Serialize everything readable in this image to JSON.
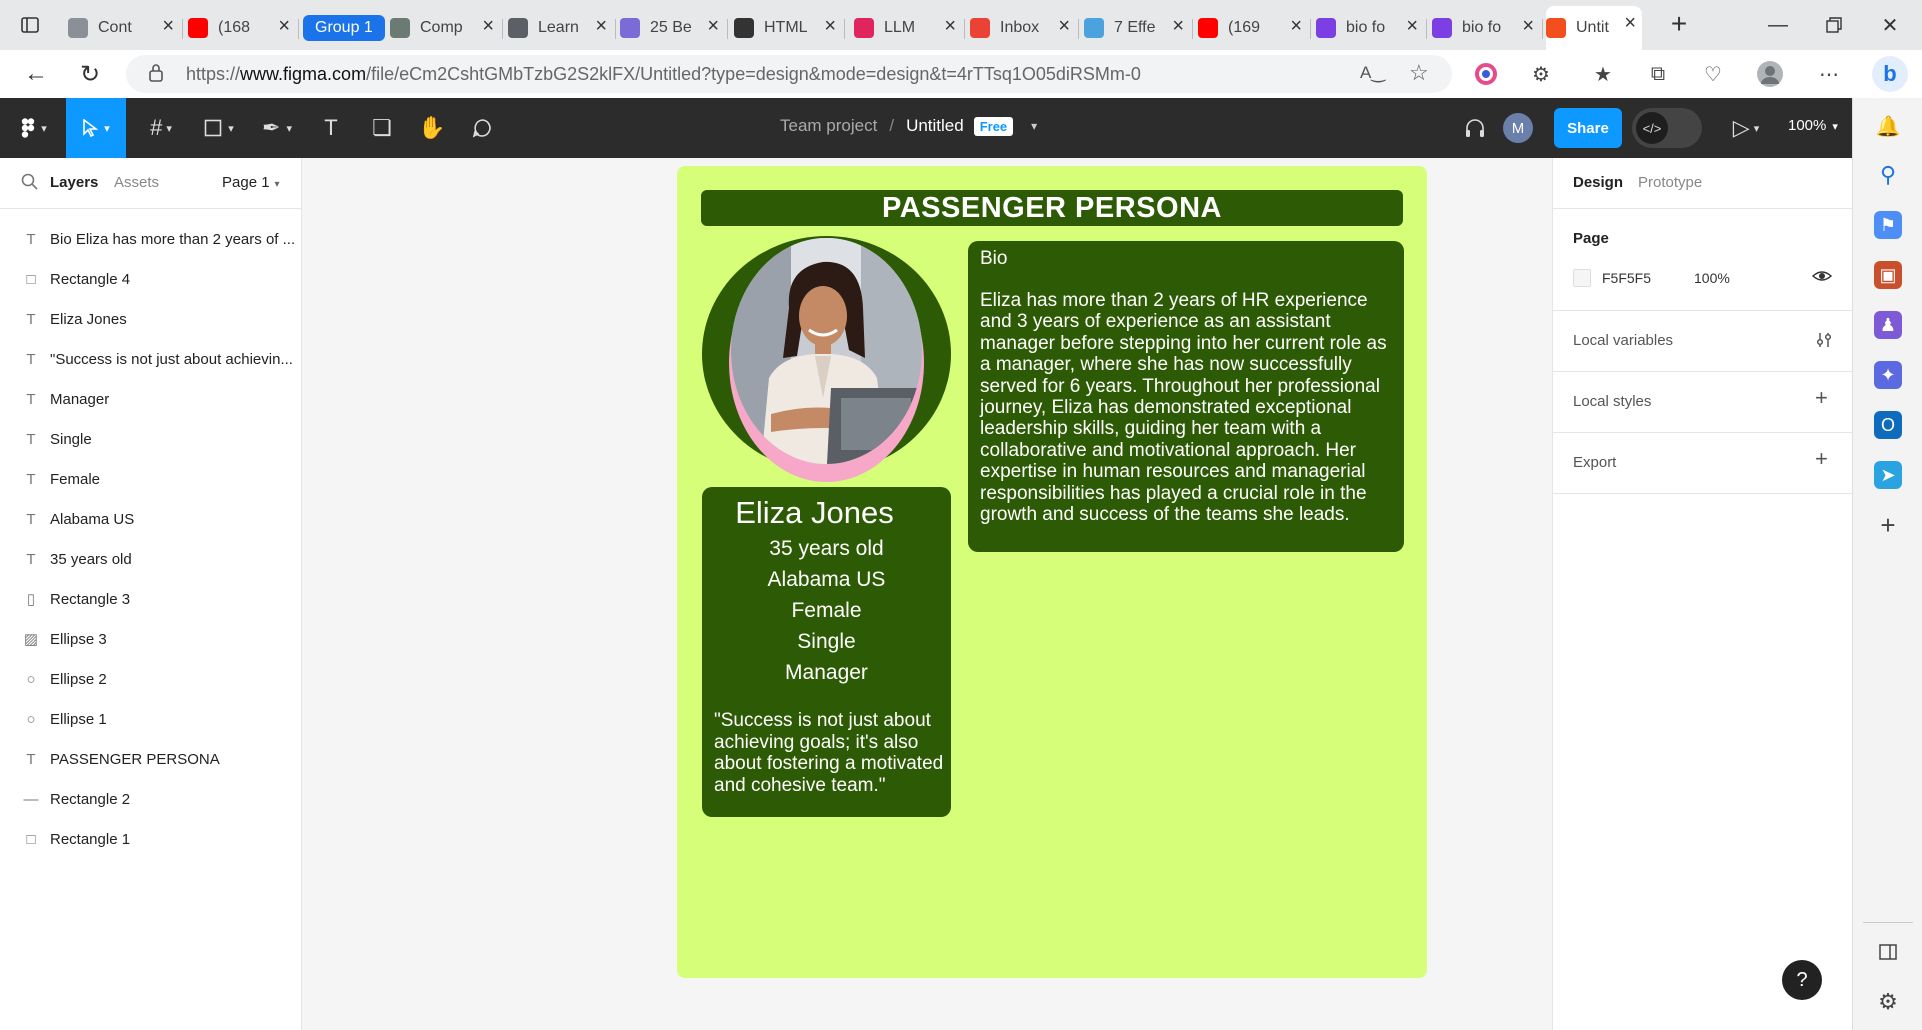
{
  "browser": {
    "tabs": [
      {
        "title": "Cont",
        "icon": "chart-icon",
        "color": "#8a8f98"
      },
      {
        "title": "(168",
        "icon": "youtube-icon",
        "color": "#ff0000"
      },
      {
        "title": "Group 1",
        "icon": "group-label",
        "color": "#1a73e8"
      },
      {
        "title": "Comp",
        "icon": "openai-icon",
        "color": "#6c7a74"
      },
      {
        "title": "Learn",
        "icon": "learn-icon",
        "color": "#5c5f66"
      },
      {
        "title": "25 Be",
        "icon": "planet-icon",
        "color": "#7b6bd6"
      },
      {
        "title": "HTML",
        "icon": "layers-icon",
        "color": "#333333"
      },
      {
        "title": "LLM",
        "icon": "m-logo-icon",
        "color": "#e0245e"
      },
      {
        "title": "Inbox",
        "icon": "gmail-icon",
        "color": "#ea4335"
      },
      {
        "title": "7 Effe",
        "icon": "star-badge-icon",
        "color": "#4aa3df"
      },
      {
        "title": "(169",
        "icon": "youtube-icon",
        "color": "#ff0000"
      },
      {
        "title": "bio fo",
        "icon": "yahoo-icon",
        "color": "#7b3fe4"
      },
      {
        "title": "bio fo",
        "icon": "yahoo-icon",
        "color": "#7b3fe4"
      },
      {
        "title": "Untit",
        "icon": "figma-icon",
        "color": "#f24e1e"
      }
    ],
    "url_prefix": "https://",
    "url_domain": "www.figma.com",
    "url_path": "/file/eCm2CshtGMbTzbG2S2klFX/Untitled?type=design&mode=design&t=4rTTsq1O05diRSMm-0"
  },
  "toolbar": {
    "project": "Team project",
    "separator": "/",
    "file_name": "Untitled",
    "plan_badge": "Free",
    "avatar_initial": "M",
    "share_label": "Share",
    "zoom": "100%"
  },
  "layers_panel": {
    "tab_layers": "Layers",
    "tab_assets": "Assets",
    "page_selector": "Page 1",
    "items": [
      {
        "name": "Bio Eliza has more than 2 years of ...",
        "type": "text"
      },
      {
        "name": "Rectangle 4",
        "type": "rectangle"
      },
      {
        "name": "Eliza Jones",
        "type": "text"
      },
      {
        "name": "\"Success is not just about achievin...",
        "type": "text"
      },
      {
        "name": "Manager",
        "type": "text"
      },
      {
        "name": "Single",
        "type": "text"
      },
      {
        "name": "Female",
        "type": "text"
      },
      {
        "name": "Alabama US",
        "type": "text"
      },
      {
        "name": "35 years old",
        "type": "text"
      },
      {
        "name": "Rectangle 3",
        "type": "rectangle-tall"
      },
      {
        "name": "Ellipse 3",
        "type": "image"
      },
      {
        "name": "Ellipse 2",
        "type": "ellipse"
      },
      {
        "name": "Ellipse 1",
        "type": "ellipse"
      },
      {
        "name": "PASSENGER PERSONA",
        "type": "text"
      },
      {
        "name": "Rectangle 2",
        "type": "line"
      },
      {
        "name": "Rectangle 1",
        "type": "rectangle"
      }
    ]
  },
  "properties_panel": {
    "tab_design": "Design",
    "tab_prototype": "Prototype",
    "page_heading": "Page",
    "page_color": "F5F5F5",
    "page_opacity": "100%",
    "local_variables": "Local variables",
    "local_styles": "Local styles",
    "export": "Export"
  },
  "persona": {
    "title": "PASSENGER PERSONA",
    "name": "Eliza Jones",
    "facts": [
      "35 years old",
      "Alabama US",
      "Female",
      "Single",
      "Manager"
    ],
    "quote": "\"Success is not just about achieving goals; it's also about fostering a motivated and cohesive team.\"",
    "bio_title": "Bio",
    "bio": "Eliza has more than 2 years of HR experience and 3 years of experience as an assistant manager before stepping into her current role as a manager, where she has now successfully served for 6 years. Throughout her professional journey, Eliza has demonstrated exceptional leadership skills, guiding her team with a collaborative and motivational approach. Her expertise in human resources and managerial responsibilities has played a crucial role in the growth and success of the teams she leads."
  },
  "colors": {
    "frame_bg": "#d6fe78",
    "dark_green": "#2d5a04",
    "figma_blue": "#0d99ff",
    "toolbar_bg": "#2c2c2c"
  },
  "help_label": "?"
}
